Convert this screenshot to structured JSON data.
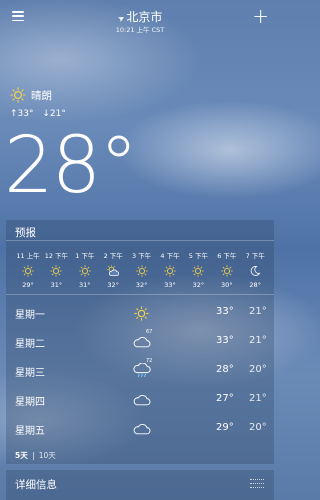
{
  "header": {
    "city": "北京市",
    "time": "10:21 上午 CST",
    "location_icon": "location-arrow-icon",
    "menu_icon": "hamburger-menu-icon",
    "add_icon": "plus-icon"
  },
  "current": {
    "condition": "晴朗",
    "condition_icon": "sun-icon",
    "high": "33°",
    "low": "21°",
    "temperature": "28°"
  },
  "forecast": {
    "title": "预报",
    "hourly": [
      {
        "time": "11 上午",
        "icon": "sun-icon",
        "temp": "29°"
      },
      {
        "time": "12 下午",
        "icon": "sun-icon",
        "temp": "31°"
      },
      {
        "time": "1 下午",
        "icon": "sun-icon",
        "temp": "31°"
      },
      {
        "time": "2 下午",
        "icon": "partly-cloudy-icon",
        "temp": "32°"
      },
      {
        "time": "3 下午",
        "icon": "sun-icon",
        "temp": "32°"
      },
      {
        "time": "4 下午",
        "icon": "sun-icon",
        "temp": "33°"
      },
      {
        "time": "5 下午",
        "icon": "sun-icon",
        "temp": "32°"
      },
      {
        "time": "6 下午",
        "icon": "sun-icon",
        "temp": "30°"
      },
      {
        "time": "7 下午",
        "icon": "moon-icon",
        "temp": "28°"
      }
    ],
    "daily": [
      {
        "day": "星期一",
        "icon": "sun-icon",
        "pop": "",
        "high": "33°",
        "low": "21°"
      },
      {
        "day": "星期二",
        "icon": "cloud-icon",
        "pop": "67",
        "high": "33°",
        "low": "21°"
      },
      {
        "day": "星期三",
        "icon": "rain-cloud-icon",
        "pop": "72",
        "high": "28°",
        "low": "20°"
      },
      {
        "day": "星期四",
        "icon": "cloud-icon",
        "pop": "",
        "high": "27°",
        "low": "21°"
      },
      {
        "day": "星期五",
        "icon": "cloud-icon",
        "pop": "",
        "high": "29°",
        "low": "20°"
      }
    ],
    "tabs": {
      "five_day": "5天",
      "ten_day": "10天"
    }
  },
  "details": {
    "title": "详细信息",
    "grip_icon": "drag-handle-icon"
  }
}
